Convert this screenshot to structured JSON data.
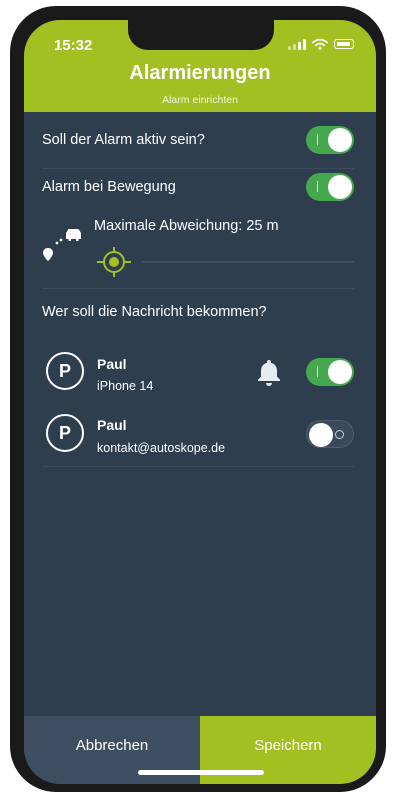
{
  "status": {
    "time": "15:32"
  },
  "header": {
    "title": "Alarmierungen",
    "subtitle": "Alarm einrichten"
  },
  "settings": {
    "alarm_active": {
      "label": "Soll der Alarm aktiv sein?",
      "on": true
    },
    "alarm_motion": {
      "label": "Alarm bei Bewegung",
      "on": true
    },
    "max_deviation": {
      "label": "Maximale Abweichung: 25 m",
      "value_m": 25
    }
  },
  "recipients": {
    "heading": "Wer soll die Nachricht bekommen?",
    "items": [
      {
        "avatar": "P",
        "name": "Paul",
        "detail": "iPhone 14",
        "icon": "bell-icon",
        "on": true
      },
      {
        "avatar": "P",
        "name": "Paul",
        "detail": "kontakt@autoskope.de",
        "on": false
      }
    ]
  },
  "footer": {
    "cancel": "Abbrechen",
    "save": "Speichern"
  },
  "colors": {
    "accent": "#a2c021",
    "background": "#2e3e4f",
    "toggle_on": "#46a84e"
  }
}
